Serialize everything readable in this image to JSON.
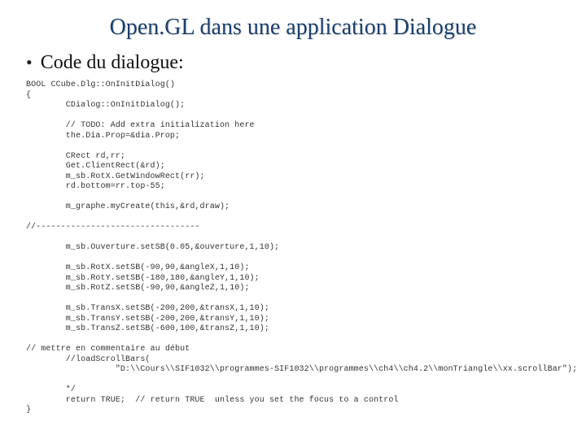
{
  "title": "Open.GL dans une application Dialogue",
  "bullet": "Code du dialogue:",
  "code_lines": [
    "BOOL CCube.Dlg::OnInitDialog()",
    "{",
    "        CDialog::OnInitDialog();",
    "",
    "        // TODO: Add extra initialization here",
    "        the.Dia.Prop=&dia.Prop;",
    "",
    "        CRect rd,rr;",
    "        Get.ClientRect(&rd);",
    "        m_sb.RotX.GetWindowRect(rr);",
    "        rd.bottom=rr.top-55;",
    "",
    "        m_graphe.myCreate(this,&rd,draw);",
    "",
    "//---------------------------------",
    "",
    "        m_sb.Ouverture.setSB(0.05,&ouverture,1,10);",
    "",
    "        m_sb.RotX.setSB(-90,90,&angleX,1,10);",
    "        m_sb.RotY.setSB(-180,180,&angleY,1,10);",
    "        m_sb.RotZ.setSB(-90,90,&angleZ,1,10);",
    "",
    "        m_sb.TransX.setSB(-200,200,&transX,1,10);",
    "        m_sb.TransY.setSB(-200,200,&transY,1,10);",
    "        m_sb.TransZ.setSB(-600,100,&transZ,1,10);",
    "",
    "// mettre en commentaire au début",
    "        //loadScrollBars(",
    "                  \"D:\\\\Cours\\\\SIF1032\\\\programmes-SIF1032\\\\programmes\\\\ch4\\\\ch4.2\\\\monTriangle\\\\xx.scrollBar\");",
    "",
    "        */",
    "        return TRUE;  // return TRUE  unless you set the focus to a control",
    "}"
  ]
}
